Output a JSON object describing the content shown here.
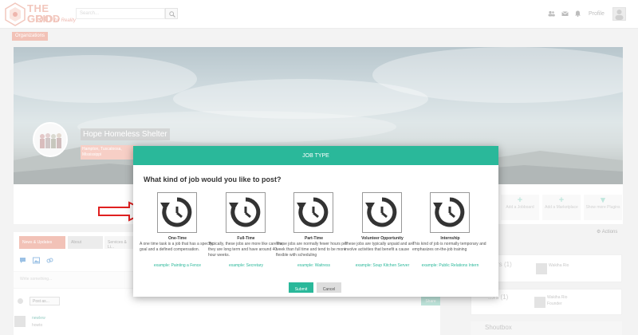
{
  "logo": {
    "line1": "THE GOOD",
    "line2": "GRID",
    "tagline": "for Reality"
  },
  "header": {
    "search_placeholder": "Search...",
    "profile_label": "Profile"
  },
  "org_tab": "Organizations",
  "org": {
    "name": "Hope Homeless Shelter",
    "location": "Hampton, Tuscaloosa, Mississippi"
  },
  "add_buttons": [
    {
      "label": "Add a Jobboard"
    },
    {
      "label": "Add a Marketplace"
    },
    {
      "label": "Show more Plugins"
    }
  ],
  "actions_label": "Actions",
  "tabs": [
    {
      "label": "News & Updates"
    },
    {
      "label": "About"
    },
    {
      "label": "Services & Li..."
    }
  ],
  "composer": {
    "placeholder": "Write something...",
    "post_as": "Post as...",
    "share": "Share"
  },
  "feed": [
    {
      "name": "newlew",
      "sub": "howto"
    }
  ],
  "right_cards": [
    {
      "title": "...ers (1)",
      "person": "Wakiha Rio"
    },
    {
      "title": "...rs (1)",
      "person": "Wakiha Rio",
      "role": "Founder"
    }
  ],
  "shoutbox": "Shoutbox",
  "modal": {
    "title": "JOB TYPE",
    "question": "What kind of job would you like to post?",
    "jobs": [
      {
        "title": "One-Time",
        "desc": "A one time task is a job that has a specific goal and a defined compensation.",
        "example": "example: Painting a Fence"
      },
      {
        "title": "Full-Time",
        "desc": "Typically, these jobs are more like careers; they are long term and have around 40 hour weeks.",
        "example": "example: Secretary"
      },
      {
        "title": "Part-Time",
        "desc": "These jobs are normally fewer hours per week than full time and tend to be more flexible with scheduling",
        "example": "example: Waitress"
      },
      {
        "title": "Volunteer Opportunity",
        "desc": "These jobs are typically unpaid and are involve activities that benefit a cause",
        "example": "example: Soup Kitchen Server"
      },
      {
        "title": "Internship",
        "desc": "This kind of job is normally temporary and emphasizes on-the-job training",
        "example": "example: Public Relations Intern"
      }
    ],
    "submit": "Submit",
    "cancel": "Cancel"
  },
  "colors": {
    "accent": "#2ab89a",
    "brand": "#e8907c",
    "arrow": "#e02020"
  }
}
